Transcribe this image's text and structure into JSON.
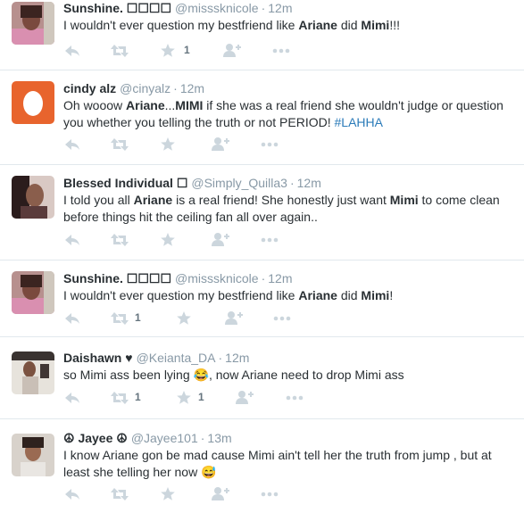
{
  "colors": {
    "name": "#292f33",
    "meta": "#8899a6",
    "icon": "#ccd6dd",
    "link": "#2b7bb9",
    "border": "#e1e8ed"
  },
  "tweets": [
    {
      "name": "Sunshine. ☐☐☐☐",
      "handle": "@misssknicole",
      "sep": "·",
      "time": "12m",
      "text_parts": [
        "I wouldn't ever question my bestfriend like ",
        "Ariane",
        " did ",
        "Mimi",
        "!!!"
      ],
      "retweets": "",
      "favorites": "1"
    },
    {
      "name": "cindy alz",
      "handle": "@cinyalz",
      "sep": "·",
      "time": "12m",
      "text_parts": [
        "Oh wooow ",
        "Ariane",
        "...",
        "MIMI",
        " if she was a real friend she wouldn't judge or question you whether you telling the truth or not PERIOD!  ",
        "#LAHHA"
      ],
      "retweets": "",
      "favorites": ""
    },
    {
      "name": "Blessed Individual ☐",
      "handle": "@Simply_Quilla3",
      "sep": "·",
      "time": "12m",
      "text_parts": [
        "I told you all ",
        "Ariane",
        " is a real friend! She honestly just want ",
        "Mimi",
        " to come clean before things hit the ceiling fan all over again.."
      ],
      "retweets": "",
      "favorites": ""
    },
    {
      "name": "Sunshine. ☐☐☐☐",
      "handle": "@misssknicole",
      "sep": "·",
      "time": "12m",
      "text_parts": [
        "I wouldn't ever question my bestfriend like ",
        "Ariane",
        " did ",
        "Mimi",
        "!"
      ],
      "retweets": "1",
      "favorites": ""
    },
    {
      "name": "Daishawn ♥",
      "handle": "@Keianta_DA",
      "sep": "·",
      "time": "12m",
      "text_parts": [
        "so Mimi ass been lying ",
        "😂",
        ", now Ariane need to drop Mimi ass"
      ],
      "retweets": "1",
      "favorites": "1"
    },
    {
      "name": "☮ Jayee ☮",
      "handle": "@Jayee101",
      "sep": "·",
      "time": "13m",
      "text_parts": [
        "I know Ariane gon be mad cause Mimi ain't tell her the truth from jump , but at least she telling her now ",
        "😅"
      ],
      "retweets": "",
      "favorites": ""
    }
  ]
}
